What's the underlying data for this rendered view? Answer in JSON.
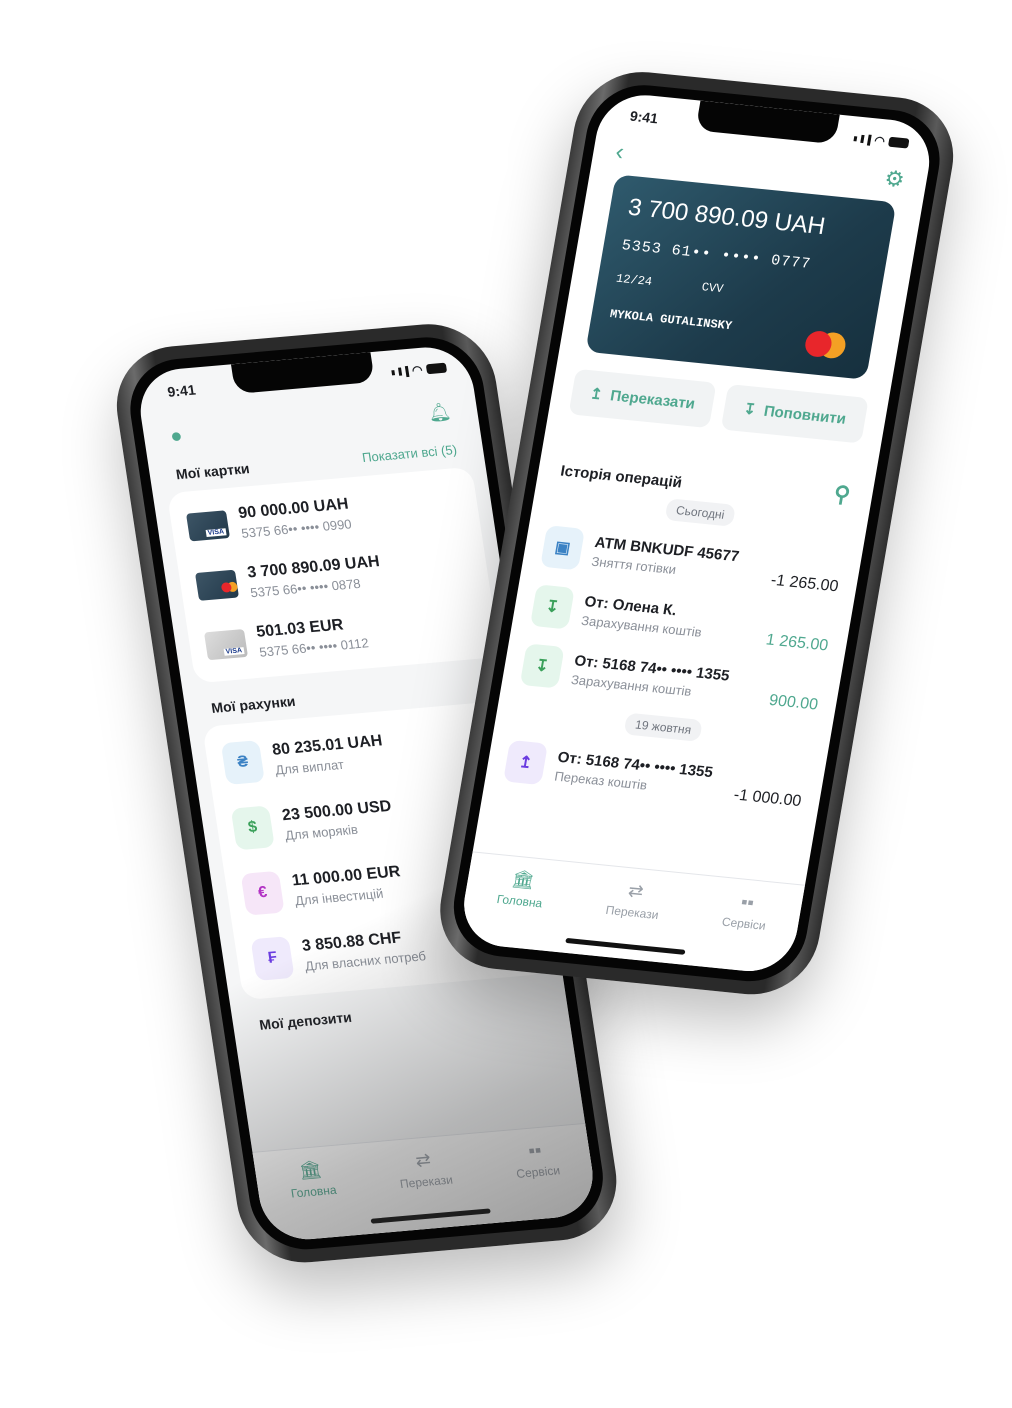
{
  "left": {
    "status_time": "9:41",
    "cards_title": "Мої картки",
    "show_all": "Показати всі (5)",
    "cards": [
      {
        "amount": "90 000.00 UAH",
        "number": "5375 66•• •••• 0990",
        "brand": "VISA"
      },
      {
        "amount": "3 700 890.09 UAH",
        "number": "5375 66•• •••• 0878",
        "brand": "mastercard"
      },
      {
        "amount": "501.03 EUR",
        "number": "5375 66•• •••• 0112",
        "brand": "VISA"
      }
    ],
    "accounts_title": "Мої рахунки",
    "accounts": [
      {
        "symbol": "₴",
        "amount": "80 235.01 UAH",
        "purpose": "Для виплат",
        "color": "#3b82c4",
        "bg": "#e6f2fa"
      },
      {
        "symbol": "$",
        "amount": "23 500.00 USD",
        "purpose": "Для моряків",
        "color": "#3aa05a",
        "bg": "#e5f6ec"
      },
      {
        "symbol": "€",
        "amount": "11 000.00 EUR",
        "purpose": "Для інвестицій",
        "color": "#b232c4",
        "bg": "#f6e6f8"
      },
      {
        "symbol": "₣",
        "amount": "3 850.88 CHF",
        "purpose": "Для власних потреб",
        "color": "#6a3ce0",
        "bg": "#efeafc"
      }
    ],
    "deposits_title": "Мої депозити"
  },
  "right": {
    "status_time": "9:41",
    "card": {
      "balance": "3 700 890.09 UAH",
      "number": "5353 61•• •••• 0777",
      "expiry": "12/24",
      "cvv": "CVV",
      "holder": "MYKOLA GUTALINSKY"
    },
    "transfer_label": "Переказати",
    "topup_label": "Поповнити",
    "history_title": "Історія операцій",
    "groups": [
      {
        "date": "Сьогодні",
        "items": [
          {
            "title": "ATM BNKUDF 45677",
            "subtitle": "Зняття готівки",
            "amount": "-1 265.00",
            "type": "atm"
          },
          {
            "title": "От: Олена К.",
            "subtitle": "Зарахування коштів",
            "amount": "1 265.00",
            "type": "in"
          },
          {
            "title": "От: 5168 74•• •••• 1355",
            "subtitle": "Зарахування коштів",
            "amount": "900.00",
            "type": "in"
          }
        ]
      },
      {
        "date": "19 жовтня",
        "items": [
          {
            "title": "От: 5168 74•• •••• 1355",
            "subtitle": "Переказ коштів",
            "amount": "-1 000.00",
            "type": "out"
          }
        ]
      }
    ]
  },
  "tabs": [
    "Головна",
    "Перекази",
    "Сервіси"
  ],
  "colors": {
    "accent": "#4fa88f",
    "card": "#1d3b4b"
  }
}
